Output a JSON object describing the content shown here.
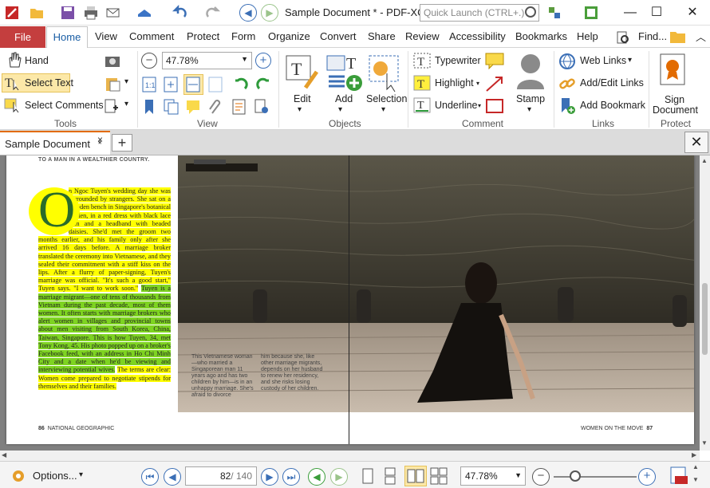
{
  "window": {
    "title": "Sample Document * - PDF-XC...",
    "quick_launch_placeholder": "Quick Launch (CTRL+.)",
    "min": "—",
    "max": "☐",
    "close": "✕"
  },
  "menu": {
    "file": "File",
    "home": "Home",
    "view": "View",
    "comment": "Comment",
    "protect": "Protect",
    "form": "Form",
    "organize": "Organize",
    "convert": "Convert",
    "share": "Share",
    "review": "Review",
    "accessibility": "Accessibility",
    "bookmarks": "Bookmarks",
    "help": "Help",
    "find": "Find...",
    "collapse": "︿"
  },
  "ribbon": {
    "tools": {
      "hand": "Hand",
      "select_text": "Select Text",
      "select_comments": "Select Comments",
      "label": "Tools"
    },
    "view": {
      "zoom": "47.78%",
      "label": "View"
    },
    "objects": {
      "edit": "Edit",
      "add": "Add",
      "selection": "Selection",
      "label": "Objects"
    },
    "comment": {
      "typewriter": "Typewriter",
      "highlight": "Highlight",
      "underline": "Underline",
      "stamp": "Stamp",
      "label": "Comment"
    },
    "links": {
      "web_links": "Web Links",
      "add_edit_links": "Add/Edit Links",
      "add_bookmark": "Add Bookmark",
      "label": "Links"
    },
    "protect": {
      "sign": "Sign",
      "document": "Document",
      "label": "Protect"
    }
  },
  "doc_tab": {
    "name": "Sample Document",
    "modified": "*",
    "close": "×",
    "add": "+",
    "close_all": "✕"
  },
  "page": {
    "header": "TO A MAN IN A WEALTHIER COUNTRY.",
    "dropcap": "O",
    "para1": "n Ngoc Tuyen's wedding day she was surrounded by strangers. She sat on a wooden bench in Singapore's botanical garden, in a red dress with black lace trim and a headband with beaded daisies. She'd met the groom two months earlier, and his family only after she arrived 16 days before. A marriage broker translated the ceremony into Vietnamese, and they sealed their commitment with a stiff kiss on the lips. After a flurry of paper-signing, Tuyen's marriage was official. \"It's such a good start,\" Tuyen says. \"I want to work soon.\"",
    "para2": "Tuyen is a marriage migrant—one of tens of thousands from Vietnam during the past decade, most of them women. It often starts with marriage brokers who alert women in villages and provincial towns about men visiting from South Korea, China, Taiwan, Singapore. This is how Tuyen, 34, met Tony Kong, 45. His photo popped up on a broker's Facebook feed, with an address in Ho Chi Minh City and a date when he'd be viewing and interviewing potential wives.",
    "para3": "The terms are clear: Women come prepared to negotiate stipends for themselves and their families.",
    "caption1": "This Vietnamese woman—who married a Singaporean man 11 years ago and has two children by him—is in an unhappy marriage. She's afraid to divorce",
    "caption2": "him because she, like other marriage migrants, depends on her husband to renew her residency, and she risks losing custody of her children.",
    "folio_left": "86",
    "mag_left": "NATIONAL GEOGRAPHIC",
    "folio_right": "87",
    "mag_right": "WOMEN ON THE MOVE"
  },
  "status": {
    "options": "Options...",
    "page_current": "82",
    "page_total": "/ 140",
    "zoom": "47.78%"
  },
  "colors": {
    "file_tab": "#c43e3e",
    "accent": "#e26b00",
    "highlight_yellow": "#ffff00",
    "highlight_green": "#7ed321"
  }
}
